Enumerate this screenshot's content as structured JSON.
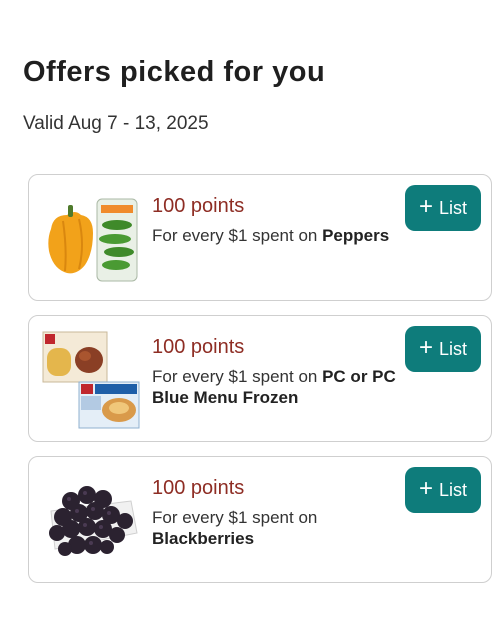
{
  "header": {
    "title": "Offers picked for you",
    "valid": "Valid Aug 7 - 13, 2025"
  },
  "offers": [
    {
      "points": "100 points",
      "desc_prefix": "For every $1 spent on ",
      "desc_product": "Peppers",
      "button_label": "List",
      "image": "peppers-image"
    },
    {
      "points": "100 points",
      "desc_prefix": "For every $1 spent on ",
      "desc_product": "PC or PC Blue Menu Frozen",
      "button_label": "List",
      "image": "pc-frozen-meals-image"
    },
    {
      "points": "100 points",
      "desc_prefix": "For every $1 spent on ",
      "desc_product": "Blackberries",
      "button_label": "List",
      "image": "blackberries-image"
    }
  ],
  "icons": {
    "add": "plus-icon"
  },
  "colors": {
    "accent": "#0e7c7b",
    "points": "#8e2d24"
  }
}
